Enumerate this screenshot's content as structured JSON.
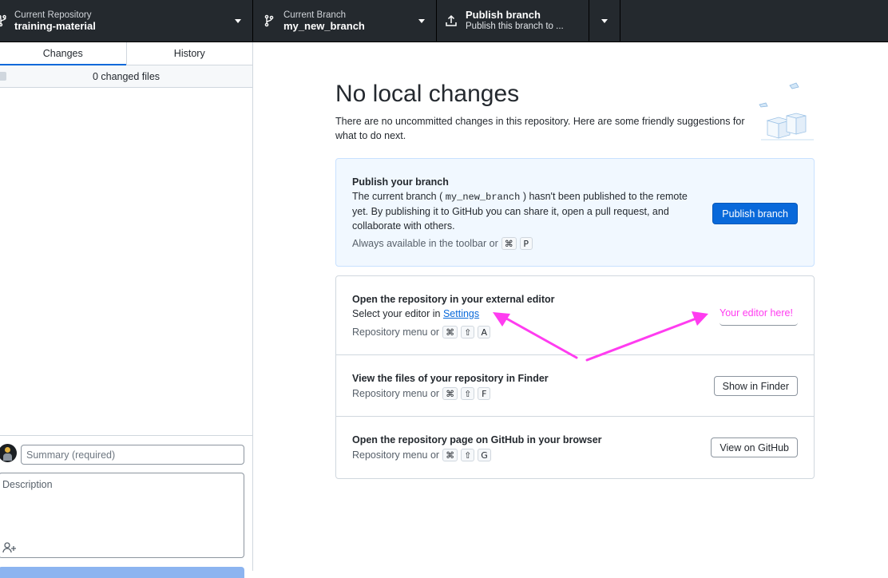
{
  "toolbar": {
    "repo": {
      "label": "Current Repository",
      "value": "training-material",
      "icon": "repo-icon"
    },
    "branch": {
      "label": "Current Branch",
      "value": "my_new_branch",
      "icon": "branch-icon"
    },
    "publish": {
      "label": "Publish branch",
      "value": "Publish this branch to ...",
      "icon": "upload-icon"
    }
  },
  "sidebar": {
    "tabs": [
      {
        "label": "Changes"
      },
      {
        "label": "History"
      }
    ],
    "changes_count": "0 changed files",
    "commit": {
      "summary_placeholder": "Summary (required)",
      "description_placeholder": "Description"
    }
  },
  "main": {
    "title": "No local changes",
    "subtitle": "There are no uncommitted changes in this repository. Here are some friendly suggestions for what to do next.",
    "publish_card": {
      "title": "Publish your branch",
      "desc_before": "The current branch ( ",
      "branch_code": "my_new_branch",
      "desc_after": " ) hasn't been published to the remote yet. By publishing it to GitHub you can share it, open a pull request, and collaborate with others.",
      "shortcut_prefix": "Always available in the toolbar or",
      "shortcut_keys": [
        "⌘",
        "P"
      ],
      "button_label": "Publish branch"
    },
    "editor_row": {
      "title": "Open the repository in your external editor",
      "desc_prefix": "Select your editor in ",
      "desc_link": "Settings",
      "shortcut_prefix": "Repository menu or",
      "shortcut_keys": [
        "⌘",
        "⇧",
        "A"
      ]
    },
    "finder_row": {
      "title": "View the files of your repository in Finder",
      "shortcut_prefix": "Repository menu or",
      "shortcut_keys": [
        "⌘",
        "⇧",
        "F"
      ],
      "button_label": "Show in Finder"
    },
    "github_row": {
      "title": "Open the repository page on GitHub in your browser",
      "shortcut_prefix": "Repository menu or",
      "shortcut_keys": [
        "⌘",
        "⇧",
        "G"
      ],
      "button_label": "View on GitHub"
    },
    "annotation": {
      "text": "Your editor here!",
      "color": "#ff3cf0"
    }
  }
}
